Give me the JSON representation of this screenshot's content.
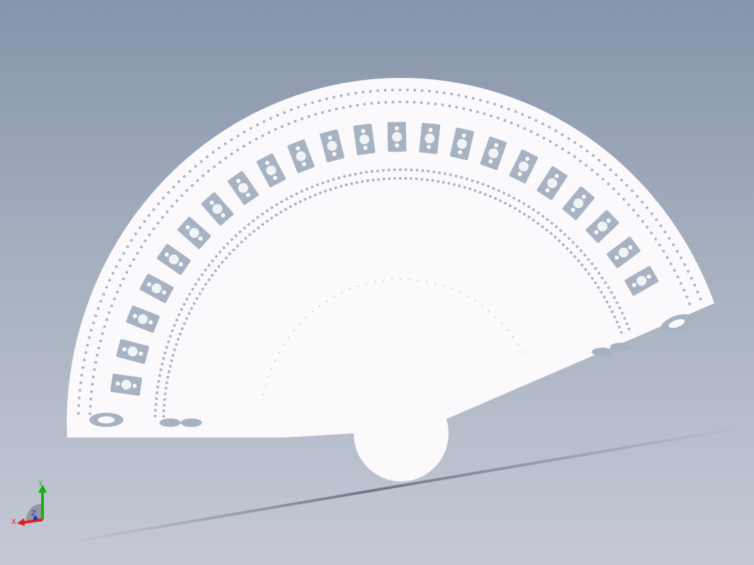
{
  "viewport": {
    "background_top": "#8795aa",
    "background_bottom": "#c5c9d5"
  },
  "model": {
    "object": "folding-fan",
    "fill_color": "#fbf9fb",
    "cutout_color": "#a7b2c3",
    "guard_count": 2,
    "ribs_panels": 22
  },
  "triad": {
    "x_label": "X",
    "y_label": "Y",
    "z_label": "Z",
    "x_color": "#e02020",
    "y_color": "#18b018",
    "z_color": "#2030d0"
  }
}
